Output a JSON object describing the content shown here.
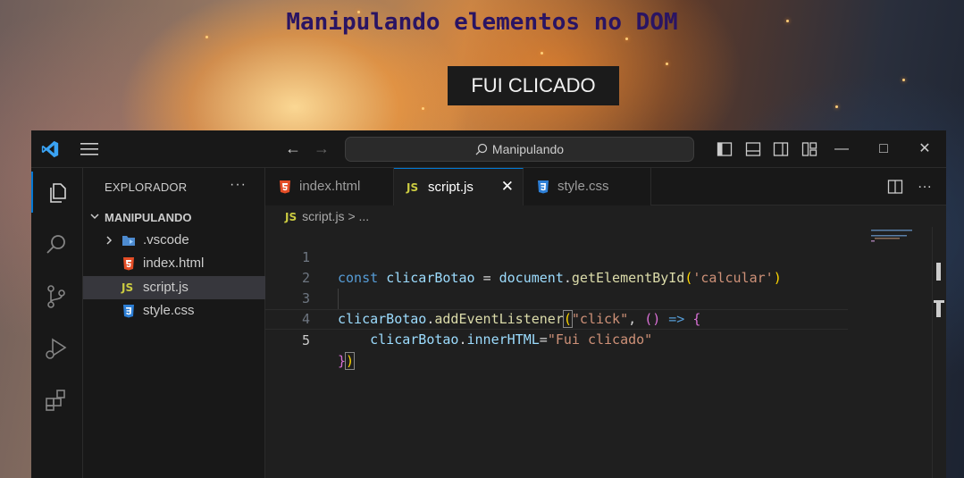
{
  "page": {
    "heading": "Manipulando elementos no DOM",
    "button_label": "FUI CLICADO"
  },
  "vscode": {
    "command_center": "Manipulando",
    "explorer": {
      "header": "EXPLORADOR",
      "more": "···",
      "folder": "MANIPULANDO",
      "items": [
        {
          "name": ".vscode",
          "icon": "vscode-folder-icon",
          "type": "folder"
        },
        {
          "name": "index.html",
          "icon": "html5-icon",
          "type": "file"
        },
        {
          "name": "script.js",
          "icon": "js-icon",
          "type": "file",
          "selected": true
        },
        {
          "name": "style.css",
          "icon": "css3-icon",
          "type": "file"
        }
      ]
    },
    "tabs": [
      {
        "label": "index.html",
        "icon": "html5-icon"
      },
      {
        "label": "script.js",
        "icon": "js-icon",
        "active": true
      },
      {
        "label": "style.css",
        "icon": "css3-icon"
      }
    ],
    "breadcrumb": {
      "icon_text": "JS",
      "file": "script.js",
      "separator": ">",
      "rest": "..."
    },
    "code": {
      "line_numbers": [
        "1",
        "2",
        "3",
        "4",
        "5"
      ],
      "current_line": 5,
      "lines": [
        "const clicarBotao = document.getElementById('calcular')",
        "",
        "clicarBotao.addEventListener(\"click\", () => {",
        "    clicarBotao.innerHTML=\"Fui clicado\"",
        "})"
      ]
    },
    "colors": {
      "accent": "#0078d4",
      "keyword": "#569cd6",
      "variable": "#9cdcfe",
      "function": "#dcdcaa",
      "string": "#ce9178"
    }
  }
}
